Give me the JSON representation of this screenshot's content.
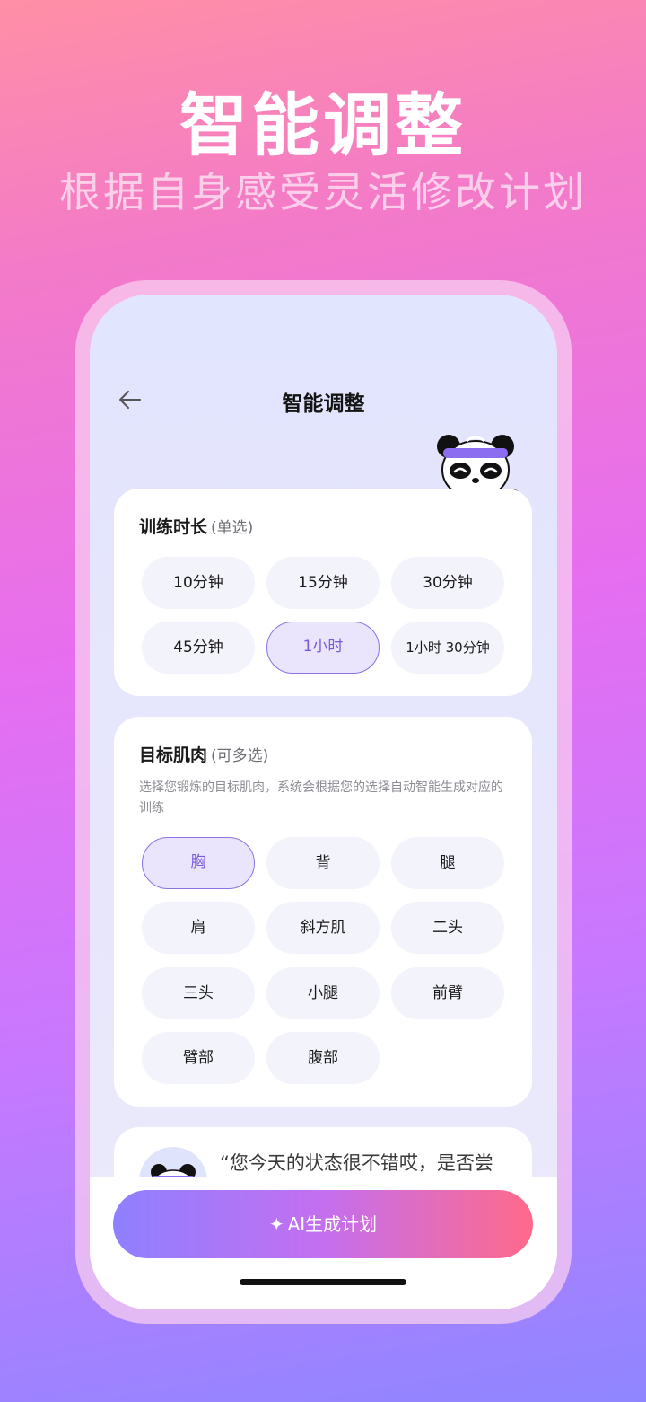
{
  "hero": {
    "title": "智能调整",
    "subtitle": "根据自身感受灵活修改计划"
  },
  "nav": {
    "back_icon": "arrow-left-icon",
    "title": "智能调整"
  },
  "duration": {
    "title": "训练时长",
    "hint": "(单选)",
    "options": [
      "10分钟",
      "15分钟",
      "30分钟",
      "45分钟",
      "1小时",
      "1小时 30分钟"
    ],
    "selected": "1小时"
  },
  "muscles": {
    "title": "目标肌肉",
    "hint": "(可多选)",
    "description": "选择您锻炼的目标肌肉，系统会根据您的选择自动智能生成对应的训练",
    "options": [
      "胸",
      "背",
      "腿",
      "肩",
      "斜方肌",
      "二头",
      "三头",
      "小腿",
      "前臂",
      "臂部",
      "腹部"
    ],
    "selected": [
      "胸"
    ]
  },
  "coach": {
    "avatar_icon": "panda-avatar-icon",
    "message": "“您今天的状态很不错哎，是否尝"
  },
  "action": {
    "icon": "sparkle-icon",
    "label": "AI生成计划"
  },
  "colors": {
    "accent": "#7a5ad8",
    "selected_bg": "#ebe4fd",
    "gradient_start": "#8e80ff",
    "gradient_end": "#ff6a8a"
  }
}
